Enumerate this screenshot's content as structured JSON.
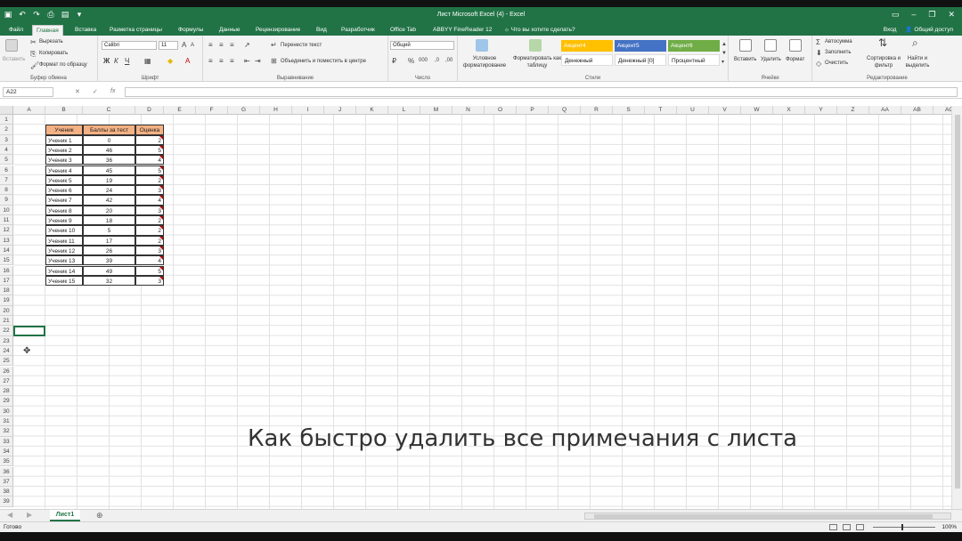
{
  "window": {
    "title": "Лист Microsoft Excel (4) - Excel",
    "signin": "Вход",
    "share": "Общий доступ"
  },
  "tabs": [
    "Файл",
    "Главная",
    "Вставка",
    "Разметка страницы",
    "Формулы",
    "Данные",
    "Рецензирование",
    "Вид",
    "Разработчик",
    "Office Tab",
    "ABBYY FineReader 12"
  ],
  "tell_me": "Что вы хотите сделать?",
  "ribbon": {
    "clipboard": {
      "paste": "Вставить",
      "cut": "Вырезать",
      "copy": "Копировать",
      "format_painter": "Формат по образцу",
      "label": "Буфер обмена"
    },
    "font": {
      "name": "Calibri",
      "size": "11",
      "label": "Шрифт"
    },
    "alignment": {
      "wrap": "Перенести текст",
      "merge": "Объединить и поместить в центре",
      "label": "Выравнивание"
    },
    "number": {
      "format": "Общий",
      "label": "Число"
    },
    "styles": {
      "conditional": "Условное форматирование",
      "as_table": "Форматировать как таблицу",
      "label": "Стили",
      "cells": [
        {
          "name": "Акцент4",
          "color": "#ffc000"
        },
        {
          "name": "Акцент5",
          "color": "#4472c4"
        },
        {
          "name": "Акцент6",
          "color": "#70ad47"
        },
        {
          "name": "Денежный",
          "color": "#ffffff"
        },
        {
          "name": "Денежный [0]",
          "color": "#ffffff"
        },
        {
          "name": "Процентный",
          "color": "#ffffff"
        }
      ]
    },
    "cells": {
      "insert": "Вставить",
      "delete": "Удалить",
      "format": "Формат",
      "label": "Ячейки"
    },
    "editing": {
      "autosum": "Автосумма",
      "fill": "Заполнить",
      "clear": "Очистить",
      "sort": "Сортировка и фильтр",
      "find": "Найти и выделить",
      "label": "Редактирование"
    }
  },
  "name_box": "A22",
  "columns": [
    "A",
    "B",
    "C",
    "D",
    "E",
    "F",
    "G",
    "H",
    "I",
    "J",
    "K",
    "L",
    "M",
    "N",
    "O",
    "P",
    "Q",
    "R",
    "S",
    "T",
    "U",
    "V",
    "W",
    "X",
    "Y",
    "Z",
    "AA",
    "AB",
    "AC"
  ],
  "row_count": 39,
  "table": {
    "headers": [
      "Ученик",
      "Баллы за тест",
      "Оценка"
    ],
    "rows": [
      [
        "Ученик 1",
        "0",
        "2"
      ],
      [
        "Ученик 2",
        "46",
        "5"
      ],
      [
        "Ученик 3",
        "36",
        "4"
      ],
      [
        "Ученик 4",
        "45",
        "5"
      ],
      [
        "Ученик 5",
        "19",
        "2"
      ],
      [
        "Ученик 6",
        "24",
        "3"
      ],
      [
        "Ученик 7",
        "42",
        "4"
      ],
      [
        "Ученик 8",
        "20",
        "3"
      ],
      [
        "Ученик 9",
        "18",
        "2"
      ],
      [
        "Ученик 10",
        "5",
        "2"
      ],
      [
        "Ученик 11",
        "17",
        "2"
      ],
      [
        "Ученик 12",
        "26",
        "3"
      ],
      [
        "Ученик 13",
        "39",
        "4"
      ],
      [
        "Ученик 14",
        "49",
        "5"
      ],
      [
        "Ученик 15",
        "32",
        "3"
      ]
    ]
  },
  "overlay_caption": "Как быстро удалить все примечания с листа",
  "sheet_tab": "Лист1",
  "status": {
    "ready": "Готово",
    "zoom": "100%"
  }
}
